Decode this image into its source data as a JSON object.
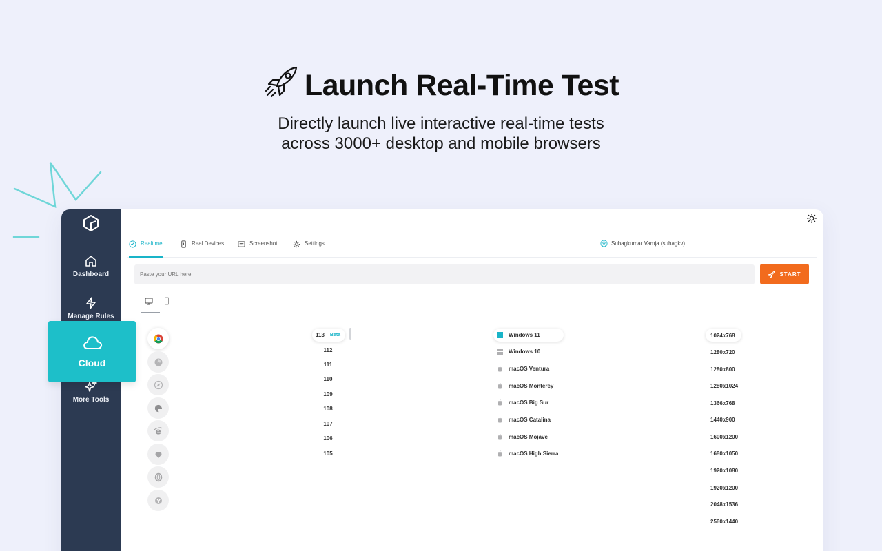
{
  "hero": {
    "title": "Launch Real-Time Test",
    "subtitle_line1": "Directly launch live interactive real-time tests",
    "subtitle_line2": "across 3000+ desktop and mobile browsers"
  },
  "sidebar": {
    "items": [
      {
        "label": "Dashboard",
        "icon": "home-icon"
      },
      {
        "label": "Manage Rules",
        "icon": "lightning-icon"
      },
      {
        "label": "More Tools",
        "icon": "sparkle-icon"
      }
    ]
  },
  "cloud_card": {
    "label": "Cloud",
    "icon": "cloud-icon"
  },
  "tabs": [
    {
      "label": "Realtime",
      "icon": "clock-icon",
      "active": true
    },
    {
      "label": "Real Devices",
      "icon": "phone-icon",
      "active": false
    },
    {
      "label": "Screenshot",
      "icon": "screenshot-icon",
      "active": false
    },
    {
      "label": "Settings",
      "icon": "gear-icon",
      "active": false
    }
  ],
  "user": {
    "name": "Suhagkumar Vamja (suhagkv)"
  },
  "url_input": {
    "placeholder": "Paste your URL here",
    "value": ""
  },
  "start_button": {
    "label": "START"
  },
  "browsers": [
    "chrome-icon",
    "firefox-icon",
    "safari-icon",
    "edge-icon",
    "ie-icon",
    "brave-icon",
    "opera-icon",
    "yandex-icon"
  ],
  "versions": {
    "selected": "113",
    "selected_badge": "Beta",
    "list": [
      "112",
      "111",
      "110",
      "109",
      "108",
      "107",
      "106",
      "105"
    ]
  },
  "os": {
    "selected": "Windows 11",
    "list": [
      "Windows 10",
      "macOS Ventura",
      "macOS Monterey",
      "macOS Big Sur",
      "macOS Catalina",
      "macOS Mojave",
      "macOS High Sierra"
    ]
  },
  "resolutions": {
    "selected": "1024x768",
    "list": [
      "1280x720",
      "1280x800",
      "1280x1024",
      "1366x768",
      "1440x900",
      "1600x1200",
      "1680x1050",
      "1920x1080",
      "1920x1200",
      "2048x1536",
      "2560x1440"
    ]
  },
  "colors": {
    "accent": "#19b4c8",
    "start": "#f26b1d",
    "sidebar": "#2c3a52",
    "cloud": "#1dbfc9"
  }
}
